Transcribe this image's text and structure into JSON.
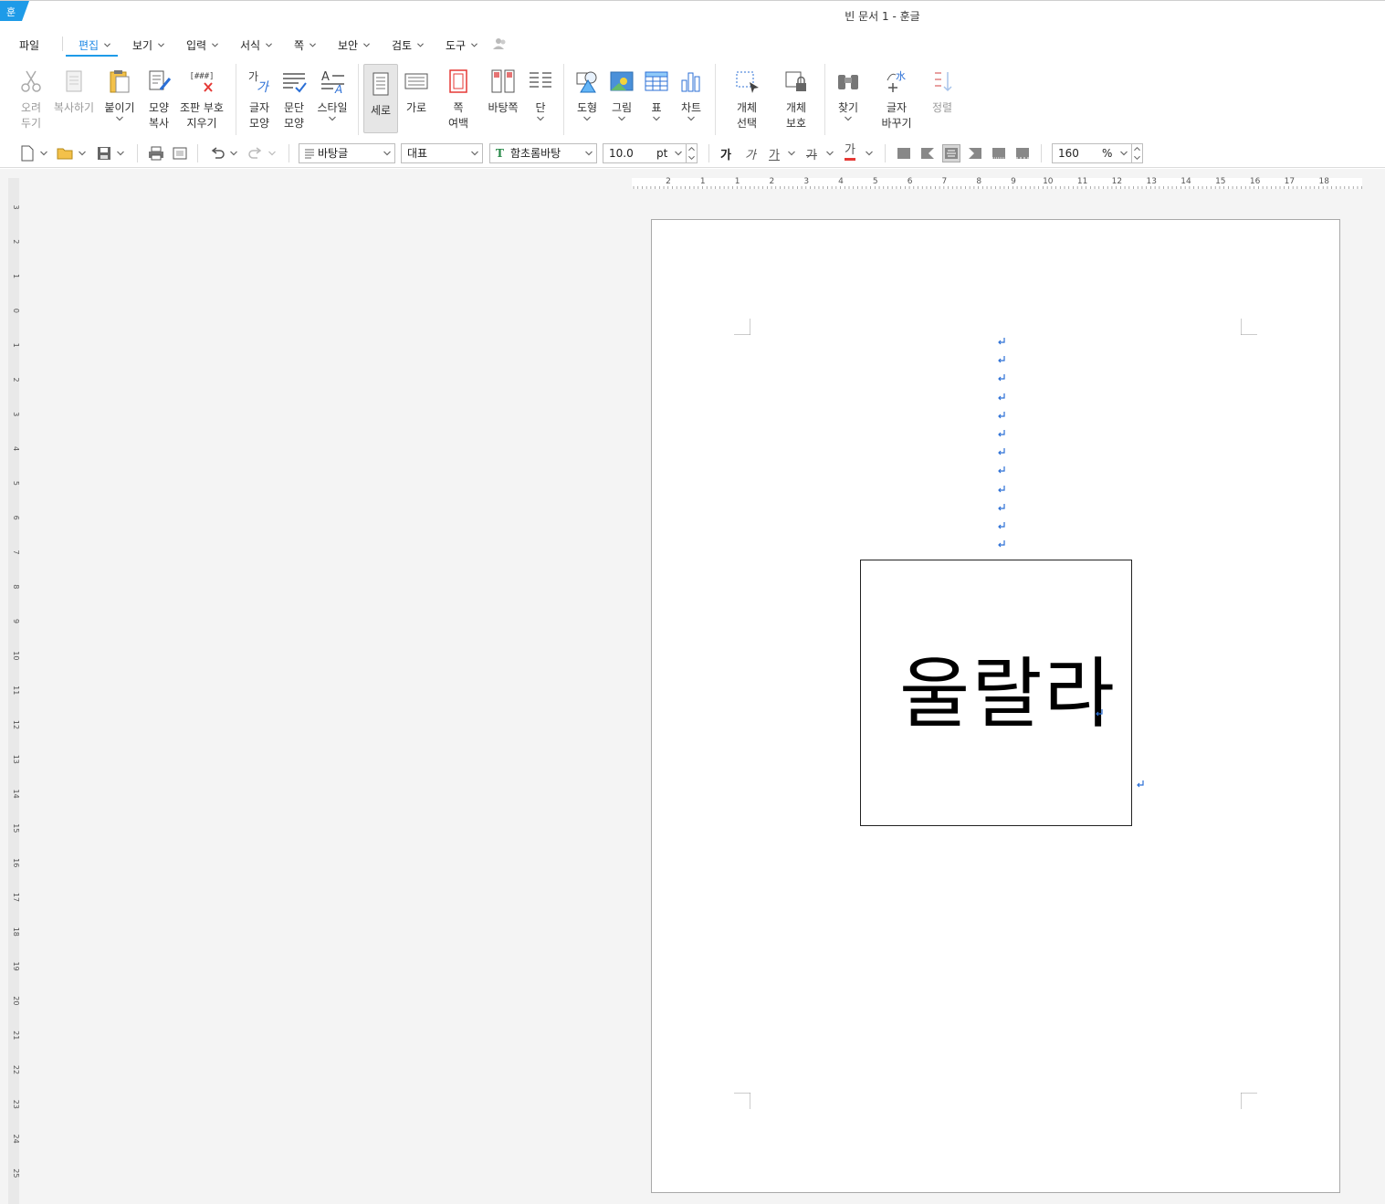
{
  "window": {
    "title": "빈 문서 1 - 훈글",
    "app_icon": "hangul-app-icon",
    "app_icon_glyph": "훈"
  },
  "menu": {
    "file": "파일",
    "items": [
      "편집",
      "보기",
      "입력",
      "서식",
      "쪽",
      "보안",
      "검토",
      "도구"
    ],
    "active": "편집"
  },
  "ribbon": {
    "cut": "오려\n두기",
    "copy": "복사하기",
    "paste": "붙이기",
    "format_copy": "모양\n복사",
    "clear_codes": "조판 부호\n지우기",
    "char_shape": "글자\n모양",
    "para_shape": "문단\n모양",
    "style": "스타일",
    "portrait": "세로",
    "landscape": "가로",
    "page_margin": "쪽\n여백",
    "background_page": "바탕쪽",
    "columns": "단",
    "shape": "도형",
    "picture": "그림",
    "table": "표",
    "chart": "차트",
    "object_select": "개체\n선택",
    "object_protect": "개체\n보호",
    "find": "찾기",
    "replace_char": "글자\n바꾸기",
    "sort": "정렬",
    "clear_codes_glyph": "[###]",
    "char_shape_glyph": "가",
    "style_glyph": "A",
    "replace_glyph": "水"
  },
  "toolbar": {
    "style_value": "바탕글",
    "lang_value": "대표",
    "font_value": "함초롬바탕",
    "font_icon": "T",
    "size_value": "10.0",
    "size_unit": "pt",
    "zoom_value": "160",
    "zoom_unit": "%",
    "bold": "가",
    "italic": "가",
    "underline": "가",
    "strike": "가",
    "color": "가"
  },
  "ruler": {
    "h_labels": [
      "2",
      "1",
      "1",
      "2",
      "3",
      "4",
      "5",
      "6",
      "7",
      "8",
      "9",
      "10",
      "11",
      "12",
      "13",
      "14",
      "15",
      "16",
      "17",
      "18"
    ],
    "v_labels": [
      "3",
      "2",
      "1",
      "0",
      "1",
      "2",
      "3",
      "4",
      "5",
      "6",
      "7",
      "8",
      "9",
      "10",
      "11",
      "12",
      "13",
      "14",
      "15",
      "16",
      "17",
      "18",
      "19",
      "20",
      "21",
      "22",
      "23",
      "24",
      "25"
    ]
  },
  "document": {
    "textbox_text": "울랄라"
  },
  "colors": {
    "accent": "#1e9be8",
    "page_bg": "#ffffff",
    "workspace_bg": "#f4f4f4",
    "para_mark": "#2b6fd6"
  }
}
